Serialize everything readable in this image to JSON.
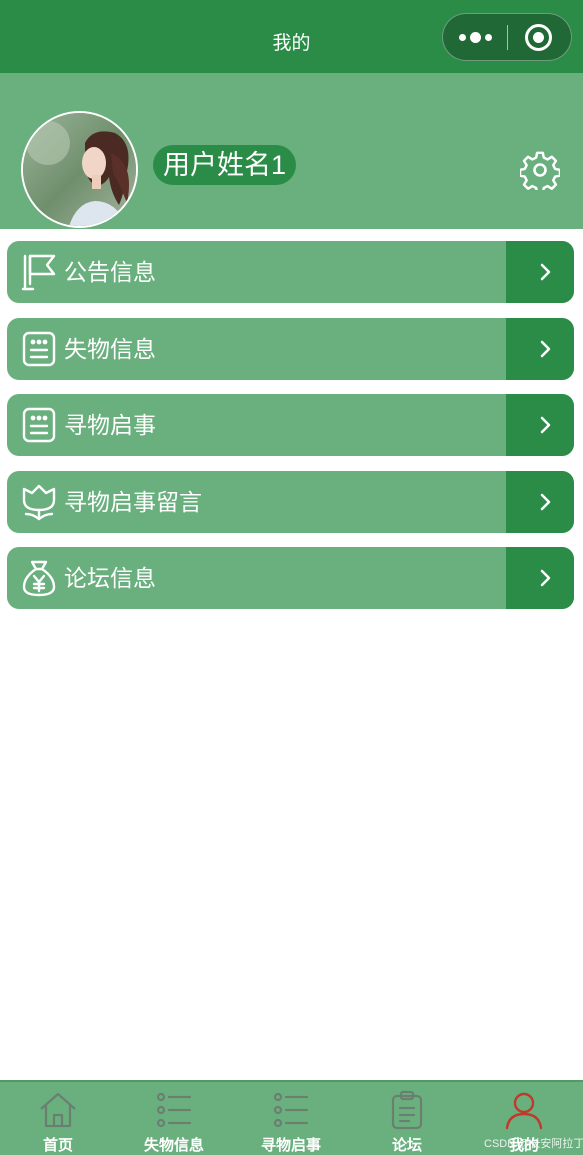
{
  "navbar": {
    "title": "我的",
    "capsule": {
      "more_icon": "more-dots-icon",
      "close_icon": "target-close-icon"
    }
  },
  "profile": {
    "avatar": "avatar-photo",
    "user_name": "用户姓名1",
    "settings_icon": "gear-icon"
  },
  "menu": [
    {
      "label": "公告信息",
      "icon": "flag-icon"
    },
    {
      "label": "失物信息",
      "icon": "document-list-icon"
    },
    {
      "label": "寻物启事",
      "icon": "document-list-icon"
    },
    {
      "label": "寻物启事留言",
      "icon": "flower-icon"
    },
    {
      "label": "论坛信息",
      "icon": "money-bag-icon"
    }
  ],
  "tabbar": [
    {
      "label": "首页",
      "icon": "home-icon",
      "active": false
    },
    {
      "label": "失物信息",
      "icon": "list-icon",
      "active": false
    },
    {
      "label": "寻物启事",
      "icon": "list-icon",
      "active": false
    },
    {
      "label": "论坛",
      "icon": "clipboard-icon",
      "active": false
    },
    {
      "label": "我的",
      "icon": "user-icon",
      "active": true
    }
  ],
  "watermark": "CSDN @长安阿拉丁",
  "colors": {
    "primary": "#2b8c48",
    "light": "#6ab07e",
    "tab_icon_inactive": "#6b7f70",
    "tab_icon_active": "#c0392b"
  }
}
